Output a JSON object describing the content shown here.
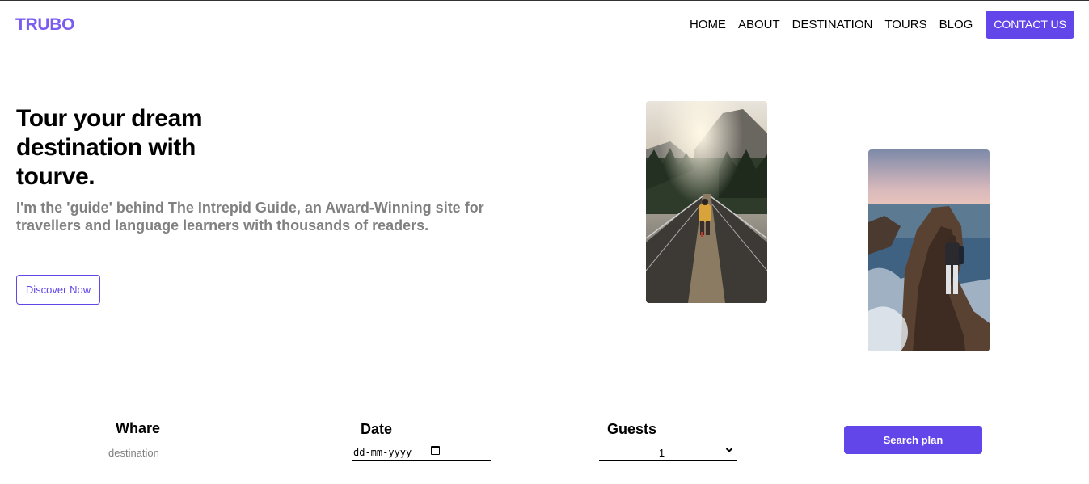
{
  "brand": {
    "logo": "TRUBO",
    "accent_color": "#6246ea"
  },
  "nav": {
    "items": [
      {
        "label": "HOME"
      },
      {
        "label": "ABOUT"
      },
      {
        "label": "DESTINATION"
      },
      {
        "label": "TOURS"
      },
      {
        "label": "BLOG"
      }
    ],
    "contact_label": "CONTACT US"
  },
  "hero": {
    "title": "Tour your dream destination with tourve.",
    "subtitle": "I'm the 'guide' behind The Intrepid Guide, an Award-Winning site for travellers and language learners with thousands of readers.",
    "cta_label": "Discover Now"
  },
  "search": {
    "where_label": "Whare",
    "where_placeholder": "destination",
    "date_label": "Date",
    "date_placeholder": "dd-mm-yyyy",
    "guests_label": "Guests",
    "guests_value": "1",
    "submit_label": "Search plan"
  },
  "icons": {
    "calendar": "calendar-icon",
    "dropdown": "chevron-down-icon"
  }
}
